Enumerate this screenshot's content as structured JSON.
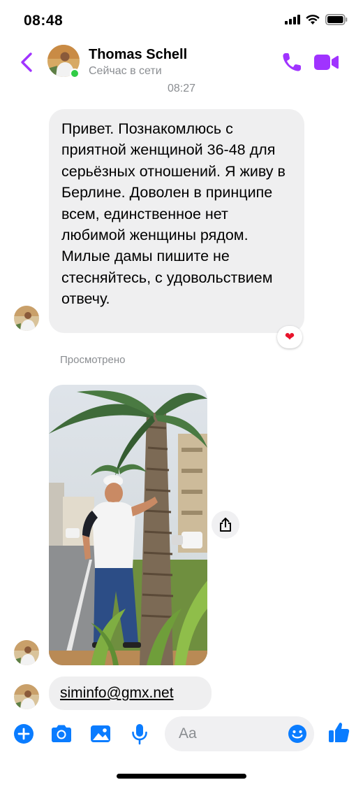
{
  "status_bar": {
    "time": "08:48"
  },
  "header": {
    "contact_name": "Thomas Schell",
    "contact_status": "Сейчас в сети"
  },
  "conversation": {
    "timestamp": "08:27",
    "messages": [
      {
        "type": "text",
        "text": "Привет. Познакомлюсь с приятной женщиной 36-48 для серьёзных отношений. Я живу в Берлине. Доволен в принципе всем, единственное нет любимой женщины рядом. Милые дамы пишите не стесняйтесь, с удовольствием отвечу.",
        "reaction": "❤"
      },
      {
        "type": "photo"
      },
      {
        "type": "text",
        "text": "siminfo@gmx.net"
      }
    ],
    "seen_label": "Просмотрено"
  },
  "composer": {
    "placeholder": "Aa"
  },
  "colors": {
    "accent": "#a033ff",
    "messenger_blue": "#0a7cff",
    "online": "#31cc46",
    "bubble": "#efeff0"
  },
  "icons": [
    "back-chevron-icon",
    "phone-icon",
    "video-camera-icon",
    "share-icon",
    "plus-icon",
    "camera-icon",
    "gallery-icon",
    "microphone-icon",
    "emoji-icon",
    "thumbs-up-icon",
    "heart-reaction-icon"
  ]
}
